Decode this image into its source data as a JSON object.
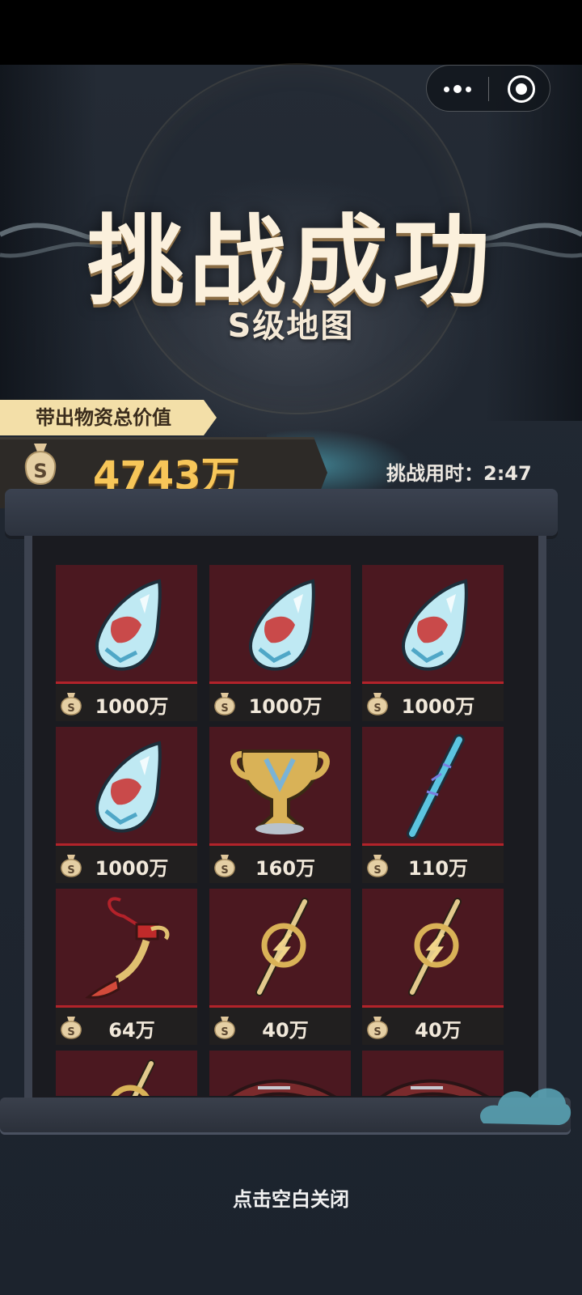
{
  "nav": {
    "more_label": "",
    "close_label": ""
  },
  "header": {
    "title": "挑战成功",
    "subtitle": "S级地图"
  },
  "summary": {
    "tag_label": "带出物资总价值",
    "total_value": "4743万",
    "time_text": "挑战用时：2:47"
  },
  "items": [
    {
      "name": "teardrop-crystal",
      "value": "1000万"
    },
    {
      "name": "teardrop-crystal",
      "value": "1000万"
    },
    {
      "name": "teardrop-crystal",
      "value": "1000万"
    },
    {
      "name": "teardrop-crystal",
      "value": "1000万"
    },
    {
      "name": "golden-trophy",
      "value": "160万"
    },
    {
      "name": "blue-staff",
      "value": "110万"
    },
    {
      "name": "red-tassel-charm",
      "value": "64万"
    },
    {
      "name": "lightning-scepter",
      "value": "40万"
    },
    {
      "name": "lightning-scepter",
      "value": "40万"
    },
    {
      "name": "lightning-scepter",
      "value": ""
    },
    {
      "name": "red-blade",
      "value": ""
    },
    {
      "name": "red-blade",
      "value": ""
    }
  ],
  "footer": {
    "close_hint": "点击空白关闭"
  },
  "colors": {
    "accent_gold": "#f7c659",
    "item_bg": "#4b1820",
    "item_line": "#b2232a"
  }
}
